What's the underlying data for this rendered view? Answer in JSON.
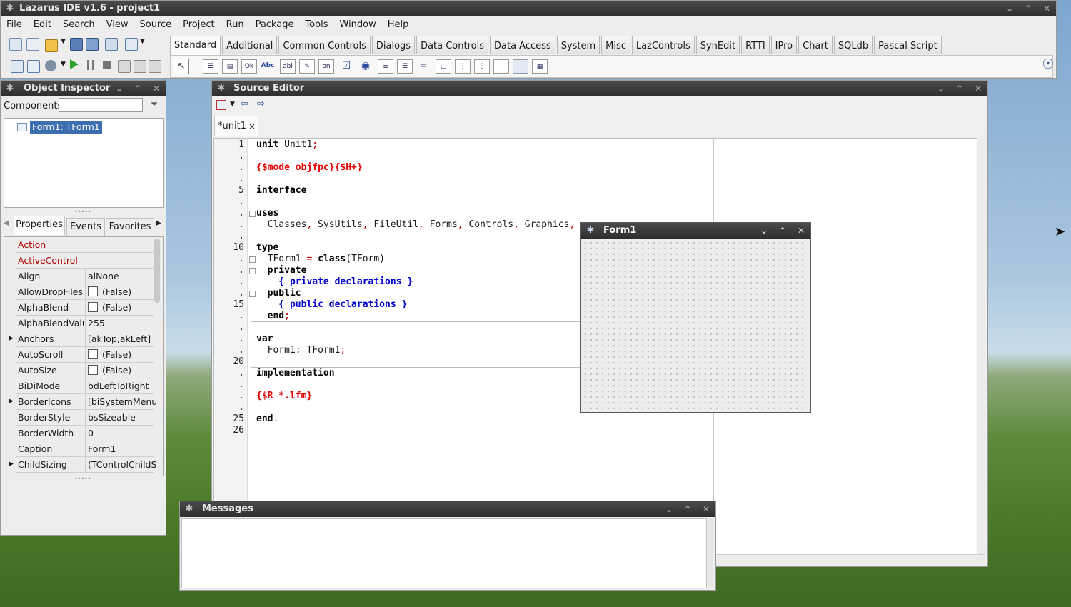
{
  "main_window": {
    "title": "Lazarus IDE v1.6 - project1",
    "menu": [
      "File",
      "Edit",
      "Search",
      "View",
      "Source",
      "Project",
      "Run",
      "Package",
      "Tools",
      "Window",
      "Help"
    ],
    "palette_tabs": [
      "Standard",
      "Additional",
      "Common Controls",
      "Dialogs",
      "Data Controls",
      "Data Access",
      "System",
      "Misc",
      "LazControls",
      "SynEdit",
      "RTTI",
      "IPro",
      "Chart",
      "SQLdb",
      "Pascal Script"
    ],
    "active_palette_tab": "Standard",
    "palette_components": [
      "Ok",
      "Abc",
      "abl",
      "on"
    ]
  },
  "object_inspector": {
    "title": "Object Inspector",
    "components_label": "Components",
    "filter_value": "",
    "tree_item": "Form1: TForm1",
    "tabs": [
      "Properties",
      "Events",
      "Favorites"
    ],
    "properties": [
      {
        "name": "Action",
        "value": "",
        "highlight": true
      },
      {
        "name": "ActiveControl",
        "value": "",
        "highlight": true
      },
      {
        "name": "Align",
        "value": "alNone"
      },
      {
        "name": "AllowDropFiles",
        "value": "(False)",
        "checkbox": true
      },
      {
        "name": "AlphaBlend",
        "value": "(False)",
        "checkbox": true
      },
      {
        "name": "AlphaBlendValue",
        "value": "255"
      },
      {
        "name": "Anchors",
        "value": "[akTop,akLeft]",
        "expand": true
      },
      {
        "name": "AutoScroll",
        "value": "(False)",
        "checkbox": true
      },
      {
        "name": "AutoSize",
        "value": "(False)",
        "checkbox": true
      },
      {
        "name": "BiDiMode",
        "value": "bdLeftToRight"
      },
      {
        "name": "BorderIcons",
        "value": "[biSystemMenu,biMinimize,biMaximize]",
        "expand": true
      },
      {
        "name": "BorderStyle",
        "value": "bsSizeable"
      },
      {
        "name": "BorderWidth",
        "value": "0"
      },
      {
        "name": "Caption",
        "value": "Form1"
      },
      {
        "name": "ChildSizing",
        "value": "(TControlChildSizing)",
        "expand": true
      }
    ]
  },
  "source_editor": {
    "title": "Source Editor",
    "tab_label": "*unit1",
    "tab_close": "×",
    "line_numbers": [
      "1",
      ".",
      ".",
      ".",
      "5",
      ".",
      ".",
      ".",
      ".",
      "10",
      ".",
      ".",
      ".",
      ".",
      "15",
      ".",
      ".",
      ".",
      ".",
      "20",
      ".",
      ".",
      ".",
      ".",
      "25",
      "26"
    ],
    "lines": [
      [
        [
          "kw",
          "unit"
        ],
        [
          "n",
          " Unit1"
        ],
        [
          "sym",
          ";"
        ]
      ],
      [],
      [
        [
          "dir",
          "{$mode objfpc}{$H+}"
        ]
      ],
      [],
      [
        [
          "kw",
          "interface"
        ]
      ],
      [],
      [
        [
          "kw",
          "uses"
        ]
      ],
      [
        [
          "n",
          "  Classes"
        ],
        [
          "sym",
          ","
        ],
        [
          "n",
          " SysUtils"
        ],
        [
          "sym",
          ","
        ],
        [
          "n",
          " FileUtil"
        ],
        [
          "sym",
          ","
        ],
        [
          "n",
          " Forms"
        ],
        [
          "sym",
          ","
        ],
        [
          "n",
          " Controls"
        ],
        [
          "sym",
          ","
        ],
        [
          "n",
          " Graphics"
        ],
        [
          "sym",
          ","
        ]
      ],
      [],
      [
        [
          "kw",
          "type"
        ]
      ],
      [
        [
          "n",
          "  TForm1 "
        ],
        [
          "sym",
          "="
        ],
        [
          "n",
          " "
        ],
        [
          "kw",
          "class"
        ],
        [
          "n",
          "(TForm)"
        ]
      ],
      [
        [
          "kw",
          "  private"
        ]
      ],
      [
        [
          "cmt",
          "    { private declarations }"
        ]
      ],
      [
        [
          "kw",
          "  public"
        ]
      ],
      [
        [
          "cmt",
          "    { public declarations }"
        ]
      ],
      [
        [
          "kw",
          "  end"
        ],
        [
          "sym",
          ";"
        ]
      ],
      [],
      [
        [
          "kw",
          "var"
        ]
      ],
      [
        [
          "n",
          "  Form1: TForm1"
        ],
        [
          "sym",
          ";"
        ]
      ],
      [],
      [
        [
          "kw",
          "implementation"
        ]
      ],
      [],
      [
        [
          "dir",
          "{$R *.lfm}"
        ]
      ],
      [],
      [
        [
          "kw",
          "end"
        ],
        [
          "sym",
          "."
        ]
      ],
      []
    ]
  },
  "form_designer": {
    "title": "Form1"
  },
  "messages": {
    "title": "Messages"
  },
  "colors": {
    "titlebar": "#333333",
    "highlight_prop": "#b00000",
    "selection": "#3d6fb0",
    "directive": "#e00000",
    "comment": "#0000cc"
  }
}
